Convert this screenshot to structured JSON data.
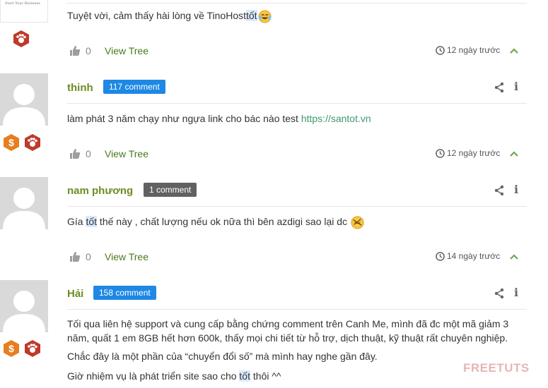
{
  "comments": [
    {
      "text": "Tuyệt vời, cảm thấy hài lòng về TinoHost",
      "highlight": "tốt",
      "avatar_logo_text": "Start Your Business",
      "likes": "0",
      "view_tree": "View Tree",
      "time": "12 ngày trước"
    },
    {
      "author": "thinh",
      "count": "117 comment",
      "text": "làm phát 3 năm chạy như ngựa link cho bác nào test ",
      "link": "https://santot.vn",
      "likes": "0",
      "view_tree": "View Tree",
      "time": "12 ngày trước"
    },
    {
      "author": "nam phương",
      "count": "1 comment",
      "text_before": "Gía ",
      "highlight": "tốt",
      "text_after": " thế này , chất lượng nếu ok nữa thì bên azdigi sao lại dc",
      "likes": "0",
      "view_tree": "View Tree",
      "time": "14 ngày trước"
    },
    {
      "author": "Hải",
      "count": "158 comment",
      "paragraphs": [
        "Tối qua liên hệ support và cung cấp bằng chứng comment trên Canh Me, mình đã đc một mã giảm 3 năm, quất 1 em 8GB hết hơn 600k, thấy mọi chi tiết từ hỗ trợ, dịch thuật, kỹ thuật rất chuyên nghiệp.",
        "Chắc đây là một phần của “chuyển đổi số” mà mình hay nghe gần đây."
      ],
      "last_before": "Giờ nhiệm vụ là phát triển site sao cho ",
      "highlight": "tốt",
      "last_after": " thôi ^^"
    }
  ],
  "watermark": "FREETUTS",
  "colors": {
    "author": "#6b8e23",
    "badge_blue": "#1e88e5",
    "badge_gray": "#616161",
    "link": "#3d9970",
    "view_tree": "#4b7b1a",
    "chevron": "#6aa84f",
    "badge_paw": "#c0392b",
    "badge_dollar": "#e67e22"
  }
}
